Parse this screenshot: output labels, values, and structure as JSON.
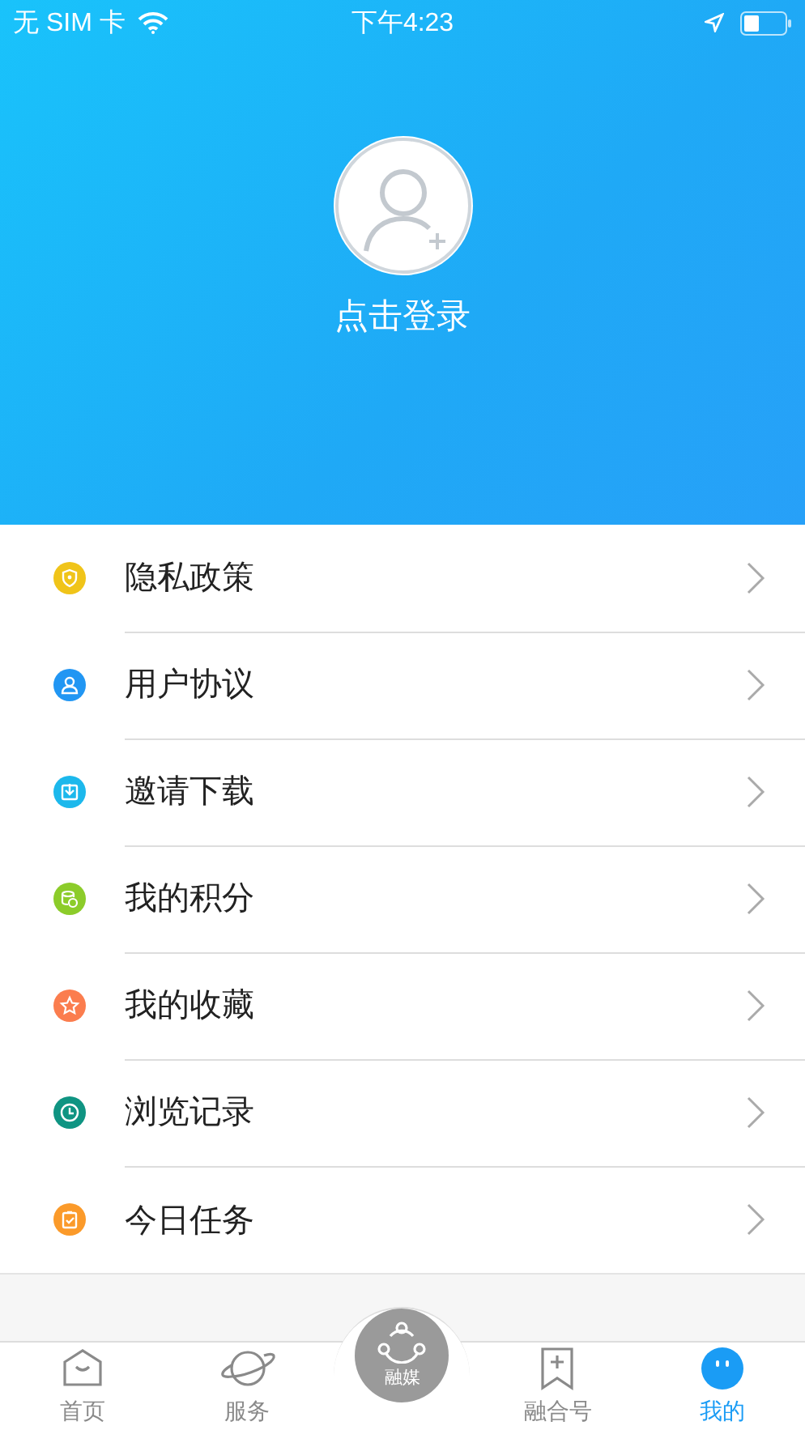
{
  "status_bar": {
    "carrier": "无 SIM 卡",
    "time": "下午4:23"
  },
  "profile": {
    "login_label": "点击登录"
  },
  "menu": [
    {
      "label": "隐私政策",
      "kind": "shield",
      "color": "#f0c419"
    },
    {
      "label": "用户协议",
      "kind": "user",
      "color": "#2196f3"
    },
    {
      "label": "邀请下载",
      "kind": "download",
      "color": "#1cb8ec"
    },
    {
      "label": "我的积分",
      "kind": "coins",
      "color": "#8ccc2a"
    },
    {
      "label": "我的收藏",
      "kind": "star",
      "color": "#fb7d4e"
    },
    {
      "label": "浏览记录",
      "kind": "clock",
      "color": "#0f9482"
    },
    {
      "label": "今日任务",
      "kind": "task",
      "color": "#fb9a2a"
    }
  ],
  "tab_bar": [
    {
      "label": "首页",
      "kind": "home",
      "selected": false
    },
    {
      "label": "服务",
      "kind": "planet",
      "selected": false
    },
    {
      "label": "融媒",
      "kind": "center",
      "selected": false
    },
    {
      "label": "融合号",
      "kind": "bookmark",
      "selected": false
    },
    {
      "label": "我的",
      "kind": "face",
      "selected": true
    }
  ]
}
